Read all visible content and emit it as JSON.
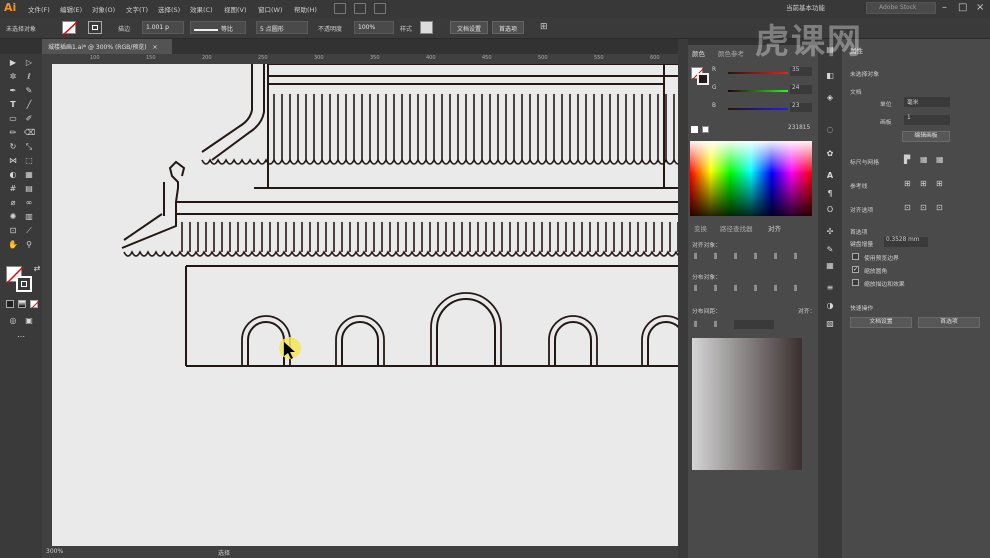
{
  "app": {
    "logo": "Ai"
  },
  "menu": {
    "items": [
      "文件(F)",
      "编辑(E)",
      "对象(O)",
      "文字(T)",
      "选择(S)",
      "效果(C)",
      "视图(V)",
      "窗口(W)",
      "帮助(H)"
    ],
    "workspace": "当前基本功能",
    "search_placeholder": "Adobe Stock"
  },
  "control": {
    "selection_label": "未选择对象",
    "stroke_label": "描边",
    "stroke_value": "1.001 p",
    "profile": "等比",
    "brush": "5 点圆形",
    "opacity_label": "不透明度",
    "opacity_value": "100%",
    "style_label": "样式",
    "doc_setup": "文档设置",
    "prefs": "首选项"
  },
  "document": {
    "tab": "城楼插画1.ai* @ 300% (RGB/预览)"
  },
  "ruler": {
    "marks": [
      "100",
      "150",
      "200",
      "250",
      "300",
      "350",
      "400",
      "450",
      "500",
      "550",
      "600"
    ]
  },
  "status": {
    "zoom": "300%",
    "tool": "选择"
  },
  "color_panel": {
    "tabs": [
      "颜色",
      "颜色参考"
    ],
    "r_label": "R",
    "r_value": "35",
    "g_label": "G",
    "g_value": "24",
    "b_label": "B",
    "b_value": "23",
    "hex": "231815"
  },
  "align_panel": {
    "tabs": [
      "变换",
      "路径查找器",
      "对齐"
    ],
    "align_objects": "对齐对象：",
    "distribute_objects": "分布对象：",
    "distribute_spacing": "分布间距：",
    "align_to": "对齐："
  },
  "right_panel": {
    "tabs": [
      "属性"
    ],
    "no_selection": "未选择对象",
    "document": "文档",
    "unit_label": "单位",
    "unit_value": "毫米",
    "artboard_label": "画板",
    "artboard_value": "1",
    "edit_artboard": "编辑画板",
    "ruler_grid": "标尺与网格",
    "guides": "参考线",
    "snap": "对齐选项",
    "preferences": "首选项",
    "keyboard_increment": "键盘增量",
    "increment_value": "0.3528 mm",
    "use_preview_bounds": "使用预览边界",
    "scale_corners": "缩放圆角",
    "scale_strokes": "缩放描边和效果",
    "quick_actions": "快速操作",
    "doc_setup": "文档设置",
    "prefs": "首选项"
  },
  "watermark": "虎课网",
  "colors": {
    "accent": "#f7931e",
    "canvas": "#eaeaea",
    "panel": "#4a4a4a",
    "line": "#231815"
  }
}
